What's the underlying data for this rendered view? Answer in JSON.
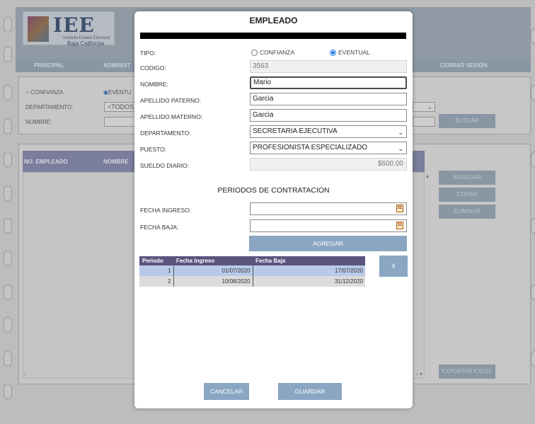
{
  "app": {
    "logo_text": "IEE",
    "logo_sub": "Instituto Estatal Electoral",
    "logo_sub2": "Baja California",
    "nav": [
      "PRINCIPAL",
      "ADMINIST",
      "CERRAR SESIÓN"
    ],
    "filter": {
      "radio_confianza": "CONFIANZA",
      "radio_eventual": "EVENTU",
      "departamento_label": "DEPARTAMENTO:",
      "departamento_value": "<TODOS",
      "nombre_label": "NOMBRE:",
      "buscar": "BUSCAR"
    },
    "grid": {
      "col_no": "NO. EMPLEADO",
      "col_nombre": "NOMBRE"
    },
    "side_buttons": [
      "AGREGAR",
      "EDITAR",
      "ELIMINAR"
    ],
    "export_button": "EXPORTAR EXCEL"
  },
  "modal": {
    "title": "EMPLEADO",
    "tipo_label": "TIPO:",
    "tipo_options": [
      "CONFIANZA",
      "EVENTUAL"
    ],
    "tipo_selected": "EVENTUAL",
    "codigo_label": "CODIGO:",
    "codigo_value": "3563",
    "nombre_label": "NOMBRE:",
    "nombre_value": "Mario",
    "apellido_paterno_label": "APELLIDO PATERNO:",
    "apellido_paterno_value": "Garcia",
    "apellido_materno_label": "APELLIDO MATERNO:",
    "apellido_materno_value": "Garcia",
    "departamento_label": "DEPARTAMENTO:",
    "departamento_value": "SECRETARIA EJECUTIVA",
    "puesto_label": "PUESTO:",
    "puesto_value": "PROFESIONISTA ESPECIALIZADO",
    "sueldo_label": "SUELDO DIARIO:",
    "sueldo_value": "$600.00",
    "periodos_title": "PERIODOS DE CONTRATACION",
    "fecha_ingreso_label": "FECHA INGRESO:",
    "fecha_baja_label": "FECHA BAJA:",
    "calendar_glyph": "31",
    "agregar_button": "AGREGAR",
    "x_button": "X",
    "table": {
      "headers": [
        "Periodo",
        "Fecha Ingreso",
        "Fecha Baja"
      ],
      "rows": [
        {
          "periodo": "1",
          "ingreso": "01/07/2020",
          "baja": "17/07/2020"
        },
        {
          "periodo": "2",
          "ingreso": "10/08/2020",
          "baja": "31/12/2020"
        }
      ]
    },
    "cancelar_button": "CANCELAR",
    "guardar_button": "GUARDAR"
  },
  "colors": {
    "modal_button": "#8aa6c2",
    "table_header": "#5a547e",
    "radio_selected": "#1e7be0"
  }
}
